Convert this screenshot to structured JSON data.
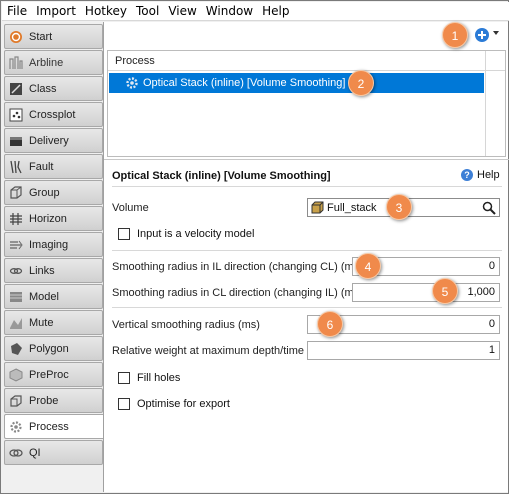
{
  "menu": [
    "File",
    "Import",
    "Hotkey",
    "Tool",
    "View",
    "Window",
    "Help"
  ],
  "sidebar": {
    "items": [
      {
        "label": "Start",
        "icon": "start-icon"
      },
      {
        "label": "Arbline",
        "icon": "arbline-icon"
      },
      {
        "label": "Class",
        "icon": "class-icon"
      },
      {
        "label": "Crossplot",
        "icon": "crossplot-icon"
      },
      {
        "label": "Delivery",
        "icon": "delivery-icon"
      },
      {
        "label": "Fault",
        "icon": "fault-icon"
      },
      {
        "label": "Group",
        "icon": "group-icon"
      },
      {
        "label": "Horizon",
        "icon": "horizon-icon"
      },
      {
        "label": "Imaging",
        "icon": "imaging-icon"
      },
      {
        "label": "Links",
        "icon": "links-icon"
      },
      {
        "label": "Model",
        "icon": "model-icon"
      },
      {
        "label": "Mute",
        "icon": "mute-icon"
      },
      {
        "label": "Polygon",
        "icon": "polygon-icon"
      },
      {
        "label": "PreProc",
        "icon": "preproc-icon"
      },
      {
        "label": "Probe",
        "icon": "probe-icon"
      },
      {
        "label": "Process",
        "icon": "process-icon"
      },
      {
        "label": "QI",
        "icon": "qi-icon"
      }
    ],
    "active": "Process"
  },
  "process_list": {
    "header": "Process",
    "selected_item": "Optical Stack (inline) [Volume Smoothing]"
  },
  "form": {
    "title": "Optical Stack (inline) [Volume Smoothing]",
    "help_label": "Help",
    "volume_label": "Volume",
    "volume_value": "Full_stack",
    "velocity_checkbox_label": "Input is a velocity model",
    "il_label": "Smoothing radius in IL direction (changing CL) (m)",
    "il_value": "0",
    "cl_label": "Smoothing radius in CL direction (changing IL) (m)",
    "cl_value": "1,000",
    "vertical_label": "Vertical smoothing radius (ms)",
    "vertical_value": "0",
    "weight_label": "Relative weight at maximum depth/time",
    "weight_value": "1",
    "fill_holes_label": "Fill holes",
    "optimise_label": "Optimise for export"
  },
  "callouts": [
    "1",
    "2",
    "3",
    "4",
    "5",
    "6"
  ],
  "colors": {
    "selection": "#0078d7",
    "callout": "#f08a4b",
    "add_button": "#2b7bd6"
  }
}
